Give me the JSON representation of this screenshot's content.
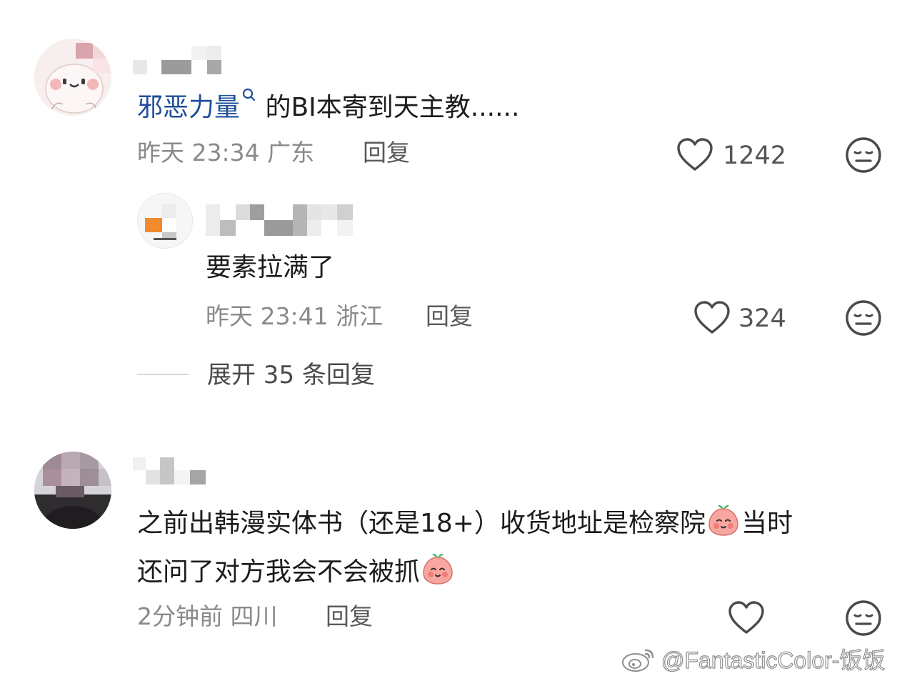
{
  "comments": [
    {
      "topic_link": "邪恶力量",
      "text": " 的BI本寄到天主教......",
      "time": "昨天 23:34",
      "location": "广东",
      "reply_label": "回复",
      "likes": "1242",
      "replies": [
        {
          "text": "要素拉满了",
          "time": "昨天 23:41",
          "location": "浙江",
          "reply_label": "回复",
          "likes": "324"
        }
      ],
      "expand_label": "展开 35 条回复"
    },
    {
      "text_line1": "之前出韩漫实体书（还是18+）收货地址是检察院",
      "text_line1_end": "当时",
      "text_line2": "还问了对方我会不会被抓",
      "time": "2分钟前",
      "location": "四川",
      "reply_label": "回复",
      "likes": ""
    }
  ],
  "watermark": {
    "text": "@FantasticColor-饭饭",
    "icon": "weibo-logo-icon"
  },
  "colors": {
    "topic_link": "#1f4e9a",
    "meta_gray": "#8a8a8a",
    "text": "#1c1c1c",
    "emoji_pink": "#f6a3a3",
    "emoji_leaf": "#3bb56b"
  }
}
